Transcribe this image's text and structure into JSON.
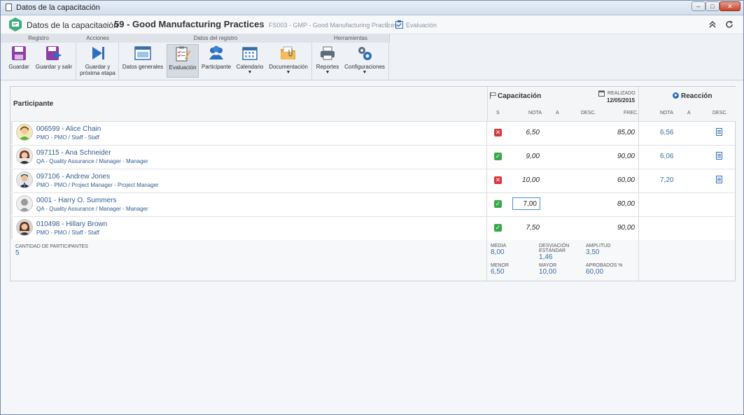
{
  "window": {
    "title": "Datos de la capacitación",
    "min": "–",
    "max": "□",
    "close": "✕"
  },
  "header": {
    "breadcrumb_root": "Datos de la capacitación",
    "separator": "›",
    "record_title": "59 - Good Manufacturing Practices",
    "pipe": "|",
    "record_code": "FS003 - GMP - Good Manufacturing Practices",
    "section": "Evaluación",
    "collapse_icon": "double-chevron-up-icon",
    "refresh_icon": "refresh-icon"
  },
  "ribbon": {
    "groups": [
      "Registro",
      "Acciones",
      "Datos del registro",
      "Herramientas"
    ],
    "buttons": {
      "guardar": "Guardar",
      "guardar_salir": "Guardar y salir",
      "guardar_etapa_1": "Guardar y",
      "guardar_etapa_2": "próxima etapa",
      "datos_generales": "Datos generales",
      "evaluacion": "Evaluación",
      "participante": "Participante",
      "calendario": "Calendario",
      "documentacion": "Documentación",
      "reportes": "Reportes",
      "configuraciones": "Configuraciones"
    },
    "caret": "▼"
  },
  "table": {
    "participant_header": "Participante",
    "capacitacion": {
      "title": "Capacitación",
      "realizado_label": "REALIZADO",
      "realizado_date": "12/05/2015",
      "sub": {
        "s": "S",
        "nota": "NOTA",
        "a": "A",
        "desc": "DESC.",
        "frec": "FREC."
      }
    },
    "reaccion": {
      "title": "Reacción",
      "sub": {
        "nota": "NOTA",
        "a": "A",
        "desc": "DESC."
      }
    },
    "rows": [
      {
        "name": "006599 - Alice Chain",
        "desc": "PMO - PMO / Staff - Staff",
        "status": "fail",
        "status_glyph": "✕",
        "nota": "6,50",
        "frec": "85,00",
        "rnota": "6,56",
        "has_desc": true
      },
      {
        "name": "097115 - Ana Schneider",
        "desc": "QA - Quality Assurance / Manager - Manager",
        "status": "pass",
        "status_glyph": "✓",
        "nota": "9,00",
        "frec": "90,00",
        "rnota": "6,06",
        "has_desc": true
      },
      {
        "name": "097106 - Andrew Jones",
        "desc": "PMO - PMO / Project Manager - Project Manager",
        "status": "fail",
        "status_glyph": "✕",
        "nota": "10,00",
        "frec": "60,00",
        "rnota": "7,20",
        "has_desc": true
      },
      {
        "name": "0001 - Harry O. Summers",
        "desc": "QA - Quality Assurance / Manager - Manager",
        "status": "pass",
        "status_glyph": "✓",
        "nota_input": "7,00",
        "frec": "80,00",
        "rnota": "",
        "has_desc": false
      },
      {
        "name": "010498 - Hillary Brown",
        "desc": "PMO - PMO / Staff - Staff",
        "status": "pass",
        "status_glyph": "✓",
        "nota": "7,50",
        "frec": "90,00",
        "rnota": "",
        "has_desc": false
      }
    ]
  },
  "footer": {
    "cantidad_label": "CANTIDAD DE PARTICIPANTES",
    "cantidad_value": "5",
    "media_label": "MEDIA",
    "media_value": "8,00",
    "desv_label_1": "DESVIACIÓN",
    "desv_label_2": "ESTÁNDAR",
    "desv_value": "1,46",
    "amplitud_label": "AMPLITUD",
    "amplitud_value": "3,50",
    "menor_label": "MENOR",
    "menor_value": "6,50",
    "mayor_label": "MAYOR",
    "mayor_value": "10,00",
    "aprobados_label": "APROBADOS %",
    "aprobados_value": "60,00"
  },
  "colors": {
    "accent": "#2f5e93",
    "pass": "#38a84a",
    "fail": "#d9363e"
  }
}
